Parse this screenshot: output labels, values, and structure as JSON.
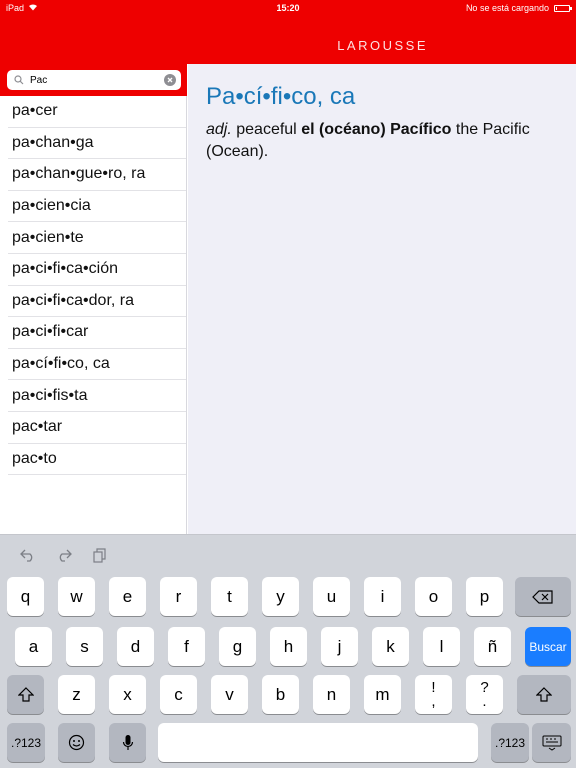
{
  "status": {
    "device": "iPad",
    "time": "15:20",
    "charging": "No se está cargando",
    "battery_level": 0.1
  },
  "app": {
    "brand": "LAROUSSE"
  },
  "search": {
    "value": "Pac",
    "placeholder": ""
  },
  "words": [
    "pa•cer",
    "pa•chan•ga",
    "pa•chan•gue•ro, ra",
    "pa•cien•cia",
    "pa•cien•te",
    "pa•ci•fi•ca•ción",
    "pa•ci•fi•ca•dor, ra",
    "pa•ci•fi•car",
    "pa•cí•fi•co, ca",
    "pa•ci•fis•ta",
    "pac•tar",
    "pac•to"
  ],
  "entry": {
    "headword": "Pa•cí•fi•co, ca",
    "pos": "adj.",
    "gloss": " peaceful ",
    "spanish": "el (océano) Pacífico",
    "english": " the Pacific (Ocean)."
  },
  "keyboard": {
    "row1": [
      "q",
      "w",
      "e",
      "r",
      "t",
      "y",
      "u",
      "i",
      "o",
      "p"
    ],
    "row2": [
      "a",
      "s",
      "d",
      "f",
      "g",
      "h",
      "j",
      "k",
      "l",
      "ñ"
    ],
    "row3": [
      "z",
      "x",
      "c",
      "v",
      "b",
      "n",
      "m"
    ],
    "punct1": {
      "top": "!",
      "bottom": ","
    },
    "punct2": {
      "top": "?",
      "bottom": "."
    },
    "numbers_label": ".?123",
    "search_label": "Buscar"
  }
}
